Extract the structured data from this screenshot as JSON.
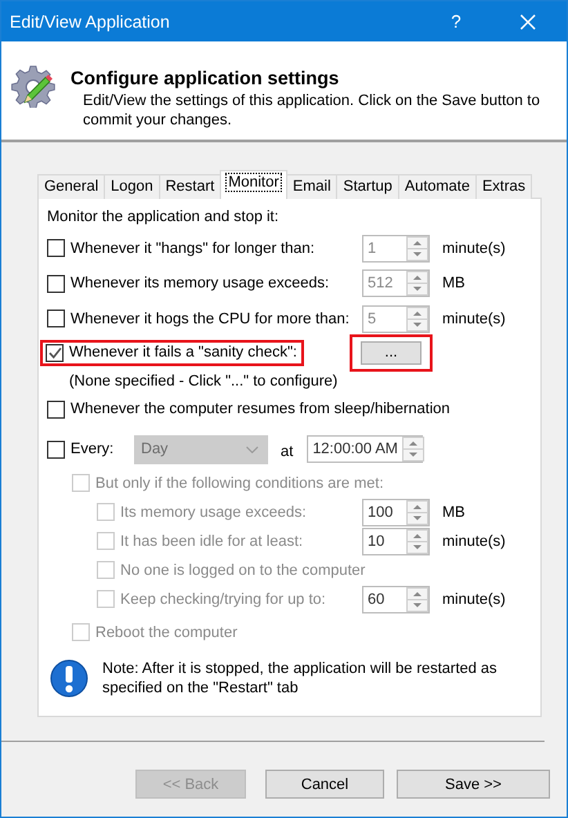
{
  "window": {
    "title": "Edit/View Application",
    "help": "?"
  },
  "header": {
    "title": "Configure application settings",
    "description": "Edit/View the settings of this application. Click on the Save button to commit your changes."
  },
  "tabs": [
    {
      "label": "General",
      "selected": false
    },
    {
      "label": "Logon",
      "selected": false
    },
    {
      "label": "Restart",
      "selected": false
    },
    {
      "label": "Monitor",
      "selected": true
    },
    {
      "label": "Email",
      "selected": false
    },
    {
      "label": "Startup",
      "selected": false
    },
    {
      "label": "Automate",
      "selected": false
    },
    {
      "label": "Extras",
      "selected": false
    }
  ],
  "monitor": {
    "heading": "Monitor the application and stop it:",
    "options": [
      {
        "kind": "spin",
        "label": "Whenever it \"hangs\" for longer than:",
        "checked": false,
        "value": "1",
        "unit": "minute(s)"
      },
      {
        "kind": "spin",
        "label": "Whenever its memory usage exceeds:",
        "checked": false,
        "value": "512",
        "unit": "MB"
      },
      {
        "kind": "spin",
        "label": "Whenever it hogs the CPU for more than:",
        "checked": false,
        "value": "5",
        "unit": "minute(s)"
      },
      {
        "kind": "button",
        "label": "Whenever it fails a \"sanity check\":",
        "checked": true,
        "button": "...",
        "highlighted": true,
        "hint": "(None specified - Click \"...\" to configure)"
      },
      {
        "kind": "plain",
        "label": "Whenever the computer resumes from sleep/hibernation",
        "checked": false
      }
    ],
    "schedule": {
      "label": "Every:",
      "checked": false,
      "dropdown": "Day",
      "at": "at",
      "time": "12:00:00 AM",
      "conditions": {
        "label": "But only if the following conditions are met:",
        "checked": false,
        "disabled": true,
        "children": [
          {
            "kind": "spin",
            "label": "Its memory usage exceeds:",
            "checked": false,
            "disabled": true,
            "value": "100",
            "unit": "MB"
          },
          {
            "kind": "spin",
            "label": "It has been idle for at least:",
            "checked": false,
            "disabled": true,
            "value": "10",
            "unit": "minute(s)"
          },
          {
            "kind": "plain",
            "label": "No one is logged on to the computer",
            "checked": false,
            "disabled": true
          },
          {
            "kind": "spin",
            "label": "Keep checking/trying for up to:",
            "checked": false,
            "disabled": true,
            "value": "60",
            "unit": "minute(s)"
          }
        ]
      },
      "reboot": {
        "label": "Reboot the computer",
        "checked": false,
        "disabled": true
      }
    },
    "note": "Note: After it is stopped, the application will be restarted as specified on the \"Restart\" tab"
  },
  "buttons": [
    {
      "label": "<< Back",
      "disabled": true
    },
    {
      "label": "Cancel",
      "disabled": false
    },
    {
      "label": "Save >>",
      "disabled": false
    }
  ]
}
